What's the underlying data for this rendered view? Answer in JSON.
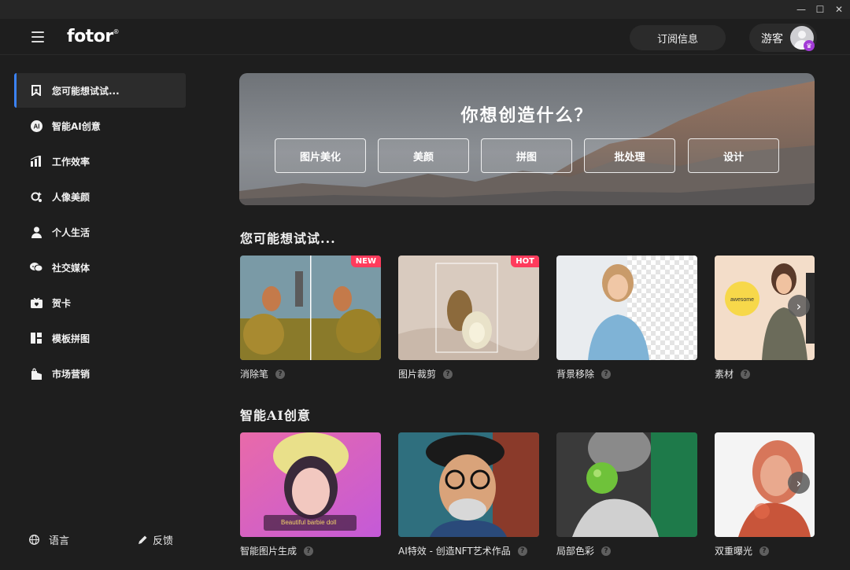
{
  "window": {
    "min": "—",
    "max": "☐",
    "close": "✕"
  },
  "header": {
    "logo": "fotor",
    "logo_mark": "®",
    "subscribe_label": "订阅信息",
    "user_name": "游客"
  },
  "sidebar": {
    "items": [
      {
        "label": "您可能想试试...",
        "icon": "bookmark-icon",
        "active": true
      },
      {
        "label": "智能AI创意",
        "icon": "ai-icon"
      },
      {
        "label": "工作效率",
        "icon": "chart-icon"
      },
      {
        "label": "人像美颜",
        "icon": "retouch-icon"
      },
      {
        "label": "个人生活",
        "icon": "person-icon"
      },
      {
        "label": "社交媒体",
        "icon": "chat-icon"
      },
      {
        "label": "贺卡",
        "icon": "card-icon"
      },
      {
        "label": "模板拼图",
        "icon": "collage-icon"
      },
      {
        "label": "市场营销",
        "icon": "bag-icon"
      }
    ],
    "language_label": "语言",
    "feedback_label": "反馈"
  },
  "hero": {
    "title": "你想创造什么？",
    "buttons": [
      "图片美化",
      "美颜",
      "拼图",
      "批处理",
      "设计"
    ]
  },
  "sections": [
    {
      "title": "您可能想试试...",
      "cards": [
        {
          "label": "消除笔",
          "badge": "NEW"
        },
        {
          "label": "图片裁剪",
          "badge": "HOT"
        },
        {
          "label": "背景移除"
        },
        {
          "label": "素材",
          "sticker_text": "awesome"
        }
      ]
    },
    {
      "title": "智能AI创意",
      "cards": [
        {
          "label": "智能图片生成",
          "prompt_text": "Beautiful barbie doll"
        },
        {
          "label": "AI特效 - 创造NFT艺术作品"
        },
        {
          "label": "局部色彩"
        },
        {
          "label": "双重曝光"
        }
      ]
    }
  ],
  "question_mark": "?",
  "next_arrow": "›",
  "colors": {
    "accent": "#3b82f6",
    "badge": "#ff3b5c",
    "crown": "#a23bd6"
  }
}
